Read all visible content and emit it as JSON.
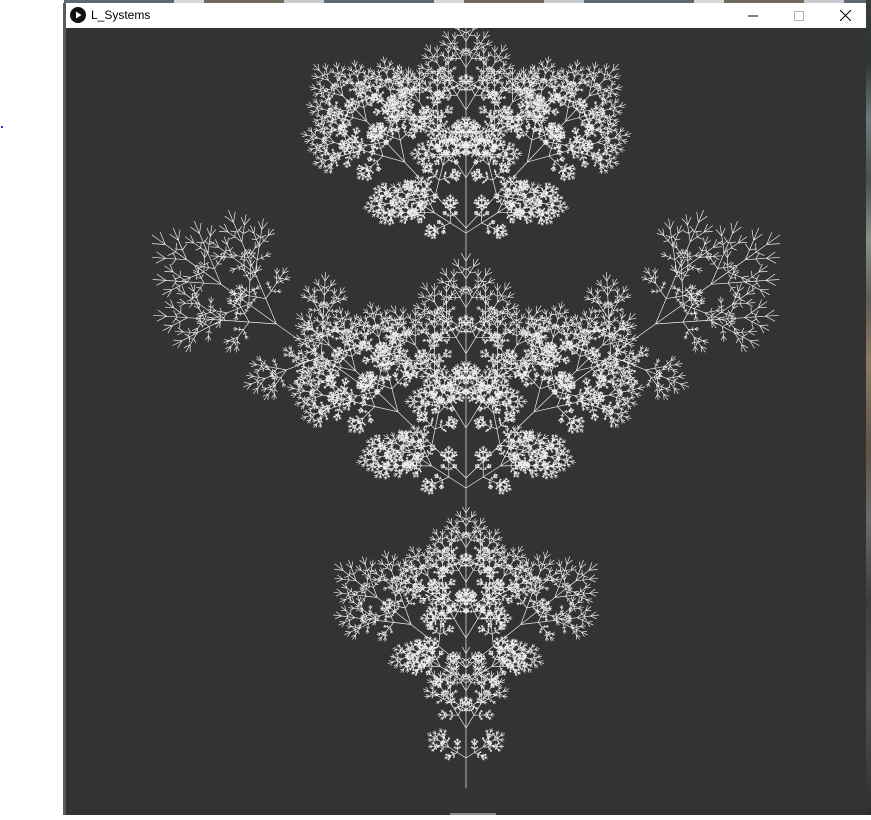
{
  "window": {
    "title": "L_Systems",
    "app_icon": "play-circle-icon",
    "controls": {
      "minimize_icon": "minimize-icon",
      "maximize_icon": "maximize-icon",
      "close_icon": "close-icon"
    }
  },
  "canvas": {
    "background_color": "#333333",
    "stroke_color": "#eeeeee",
    "figure": "l-system-fractal"
  }
}
